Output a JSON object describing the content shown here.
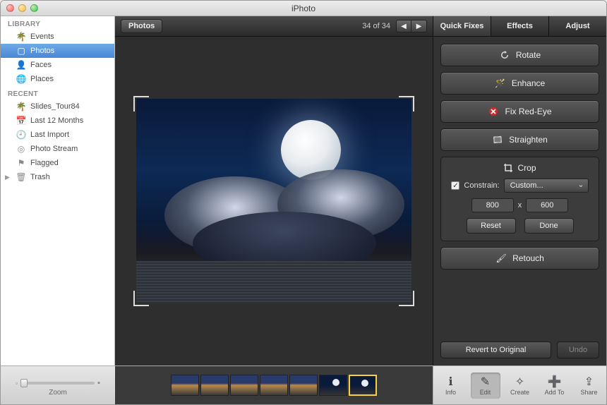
{
  "window": {
    "title": "iPhoto"
  },
  "sidebar": {
    "sections": [
      {
        "header": "LIBRARY",
        "items": [
          {
            "label": "Events",
            "icon": "events"
          },
          {
            "label": "Photos",
            "icon": "photos",
            "selected": true
          },
          {
            "label": "Faces",
            "icon": "faces"
          },
          {
            "label": "Places",
            "icon": "places"
          }
        ]
      },
      {
        "header": "RECENT",
        "items": [
          {
            "label": "Slides_Tour84",
            "icon": "event"
          },
          {
            "label": "Last 12 Months",
            "icon": "calendar"
          },
          {
            "label": "Last Import",
            "icon": "last-import"
          },
          {
            "label": "Photo Stream",
            "icon": "stream"
          },
          {
            "label": "Flagged",
            "icon": "flag"
          },
          {
            "label": "Trash",
            "icon": "trash",
            "disclose": true
          }
        ]
      }
    ]
  },
  "toolbar": {
    "breadcrumb": "Photos",
    "counter": "34 of 34"
  },
  "editTabs": {
    "tabs": [
      "Quick Fixes",
      "Effects",
      "Adjust"
    ],
    "active": 0
  },
  "quickFixes": {
    "rotate": "Rotate",
    "enhance": "Enhance",
    "redeye": "Fix Red-Eye",
    "straighten": "Straighten",
    "crop": {
      "title": "Crop",
      "constrain_label": "Constrain:",
      "constrain_checked": true,
      "constrain_mode": "Custom...",
      "width": "800",
      "height": "600",
      "x": "x",
      "reset": "Reset",
      "done": "Done"
    },
    "retouch": "Retouch",
    "revert": "Revert to Original",
    "undo": "Undo"
  },
  "footer": {
    "zoom": "Zoom",
    "buttons": [
      "Info",
      "Edit",
      "Create",
      "Add To",
      "Share"
    ],
    "active_button": 1,
    "thumbnails": 7
  }
}
